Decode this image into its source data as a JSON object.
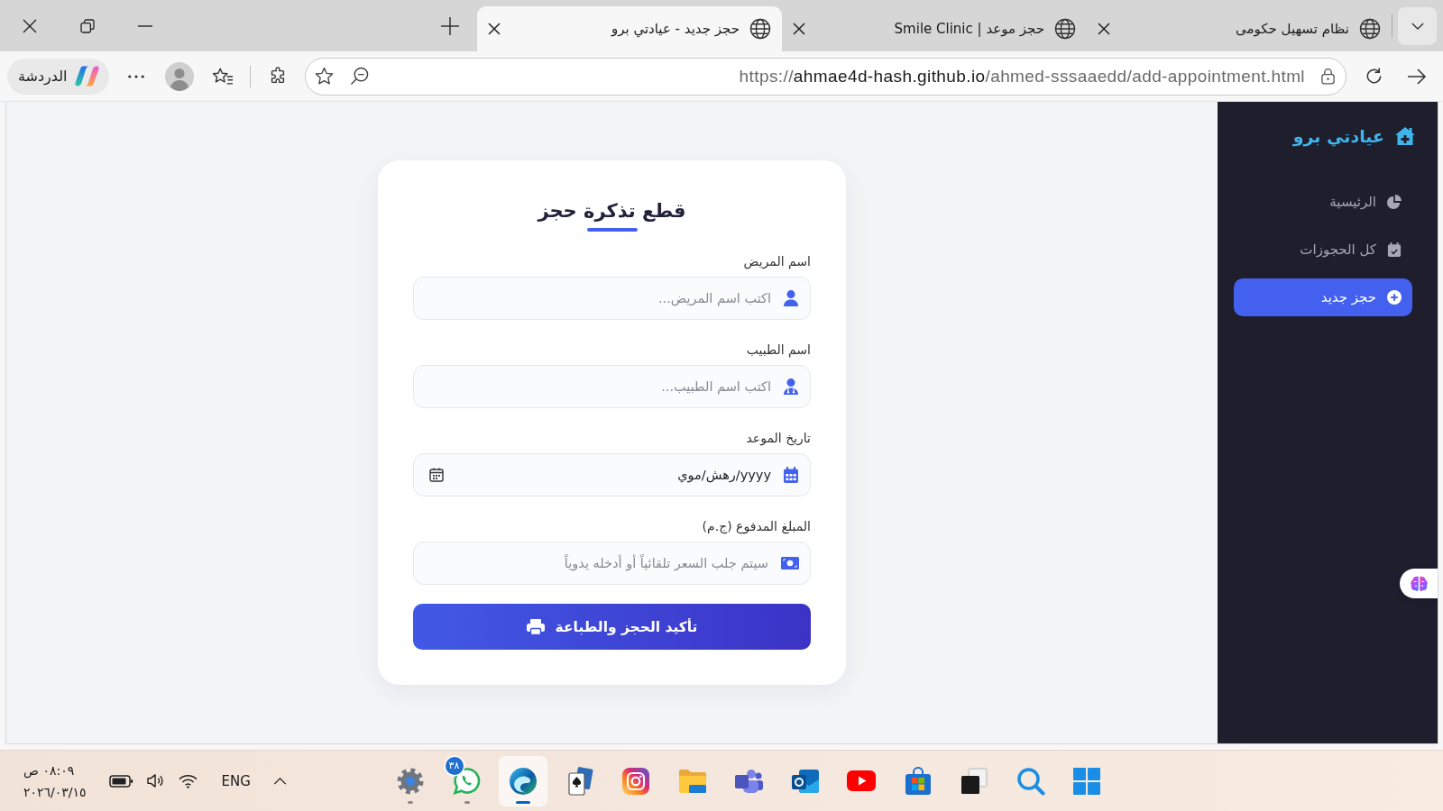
{
  "browser": {
    "tabs": [
      {
        "title": "نظام تسهيل حكومى",
        "selected": false
      },
      {
        "title": "حجز موعد | Smile Clinic",
        "selected": false
      },
      {
        "title": "حجز جديد - عيادتي برو",
        "selected": true
      }
    ],
    "chat_button": {
      "label": "الدردشة"
    },
    "address_bar": {
      "scheme": "https://",
      "host": "ahmae4d-hash.github.io",
      "path": "/ahmed-sssaaedd/add-appointment.html"
    }
  },
  "sidebar": {
    "brand": "عيادتي برو",
    "items": [
      {
        "kind": "dashboard",
        "label": "الرئيسية",
        "selected": false
      },
      {
        "kind": "bookings",
        "label": "كل الحجوزات",
        "selected": false
      },
      {
        "kind": "new",
        "label": "حجز جديد",
        "selected": true
      }
    ]
  },
  "form": {
    "title": "قطع تذكرة حجز",
    "fields": [
      {
        "kind": "patient",
        "label": "اسم المريض",
        "placeholder": "اكتب اسم المريض..."
      },
      {
        "kind": "doctor",
        "label": "اسم الطبيب",
        "placeholder": "اكتب اسم الطبيب..."
      },
      {
        "kind": "date",
        "label": "تاريخ الموعد",
        "value": "yyyy/رهش/موي"
      },
      {
        "kind": "amount",
        "label": "المبلغ المدفوع (ج.م)",
        "placeholder": "سيتم جلب السعر تلقائياً أو أدخله يدوياً"
      }
    ],
    "submit": "تأكيد الحجز والطباعة"
  },
  "taskbar": {
    "apps": [
      {
        "kind": "start",
        "running": false,
        "selected": false
      },
      {
        "kind": "search",
        "running": false,
        "selected": false
      },
      {
        "kind": "squares",
        "running": false,
        "selected": false
      },
      {
        "kind": "store",
        "running": false,
        "selected": false
      },
      {
        "kind": "video",
        "running": false,
        "selected": false
      },
      {
        "kind": "mail",
        "running": false,
        "selected": false
      },
      {
        "kind": "people",
        "running": false,
        "selected": false
      },
      {
        "kind": "folder",
        "running": false,
        "selected": false
      },
      {
        "kind": "camera",
        "running": false,
        "selected": false
      },
      {
        "kind": "cards",
        "running": false,
        "selected": false
      },
      {
        "kind": "browser",
        "running": true,
        "selected": true
      },
      {
        "kind": "chat",
        "running": true,
        "selected": false,
        "badge": "٣٨"
      },
      {
        "kind": "settings",
        "running": true,
        "selected": false
      }
    ],
    "language": "ENG",
    "time": "٠٨:٠٩ ص",
    "date": "٢٠٢٦/٠٣/١٥"
  }
}
